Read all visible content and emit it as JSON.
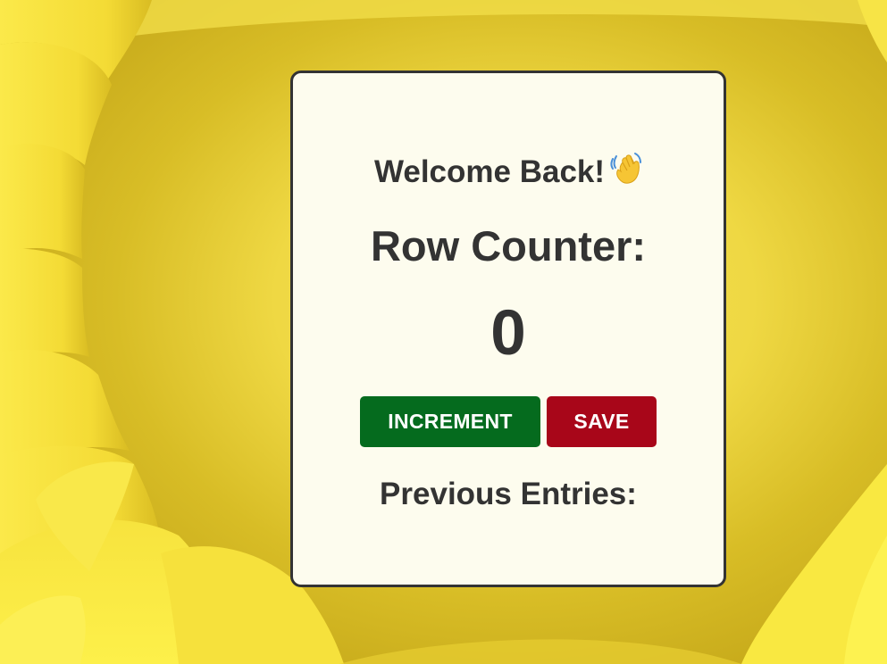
{
  "greeting": {
    "text": "Welcome Back!",
    "icon": "waving-hand-icon"
  },
  "counter": {
    "label": "Row Counter:",
    "value": "0"
  },
  "buttons": {
    "increment_label": "INCREMENT",
    "save_label": "SAVE"
  },
  "history": {
    "title": "Previous Entries:",
    "entries": []
  },
  "colors": {
    "background": "#f2dc3e",
    "card": "#fdfcee",
    "text": "#333333",
    "increment": "#056b1e",
    "save": "#a80619"
  }
}
